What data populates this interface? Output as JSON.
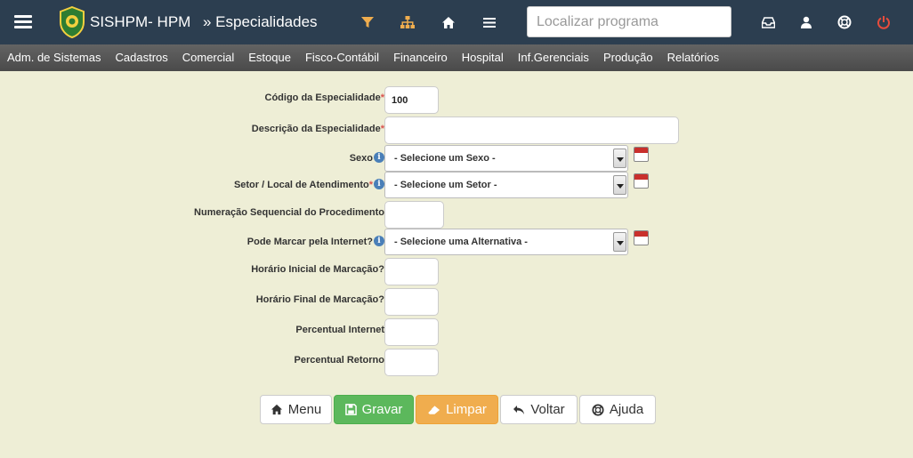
{
  "header": {
    "app_title": "SISHPM- HPM",
    "page_crumb": "» Especialidades",
    "search_placeholder": "Localizar programa",
    "icons": [
      "menu-icon",
      "filter-icon",
      "sitemap-icon",
      "home-icon",
      "list-icon",
      "inbox-icon",
      "user-icon",
      "support-icon",
      "power-icon"
    ],
    "colors": {
      "bar": "#2c3e50",
      "filter": "#f0ad4e",
      "power": "#e74c3c"
    }
  },
  "menubar": {
    "items": [
      "Adm. de Sistemas",
      "Cadastros",
      "Comercial",
      "Estoque",
      "Fisco-Contábil",
      "Financeiro",
      "Hospital",
      "Inf.Gerenciais",
      "Produção",
      "Relatórios"
    ]
  },
  "form": {
    "codigo_label": "Código da Especialidade",
    "codigo_value": "100",
    "descricao_label": "Descrição da Especialidade",
    "descricao_value": "",
    "sexo_label": "Sexo",
    "sexo_value": "- Selecione um Sexo -",
    "setor_label": "Setor / Local de Atendimento",
    "setor_value": "- Selecione um Setor -",
    "numeracao_label": "Numeração Sequencial do Procedimento",
    "numeracao_value": "",
    "internet_label": "Pode Marcar pela Internet?",
    "internet_value": "- Selecione uma Alternativa -",
    "horario_inicial_label": "Horário Inicial de Marcação?",
    "horario_inicial_value": "",
    "horario_final_label": "Horário Final de Marcação?",
    "horario_final_value": "",
    "percentual_internet_label": "Percentual Internet",
    "percentual_internet_value": "",
    "percentual_retorno_label": "Percentual Retorno",
    "percentual_retorno_value": "",
    "required_mark": "*"
  },
  "buttons": {
    "menu": "Menu",
    "gravar": "Gravar",
    "limpar": "Limpar",
    "voltar": "Voltar",
    "ajuda": "Ajuda"
  }
}
